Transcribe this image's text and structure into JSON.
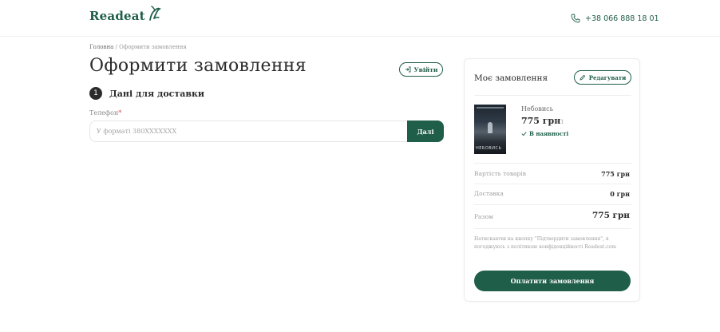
{
  "header": {
    "logo_text": "Readeat",
    "phone": "+38 066 888 18 01"
  },
  "breadcrumb": {
    "home": "Головна",
    "separator": "/",
    "current": "Оформити замовлення"
  },
  "page_title": "Оформити замовлення",
  "login_button": "Увійти",
  "step": {
    "number": "1",
    "title": "Дані для доставки"
  },
  "phone_field": {
    "label": "Телефон",
    "required_mark": "*",
    "placeholder": "У форматі 380XXXXXXX",
    "value": ""
  },
  "next_button": "Далі",
  "order": {
    "title": "Моє замовлення",
    "edit_button": "Редагувати",
    "item": {
      "name": "Небовись",
      "price": "775 грн",
      "qty": "x 1",
      "stock": "В наявності",
      "cover_text": "НЕБОВИСЬ"
    },
    "goods_label": "Вартість товарів",
    "goods_value": "775 грн",
    "delivery_label": "Доставка",
    "delivery_value": "0 грн",
    "total_label": "Разом",
    "total_value": "775 грн",
    "terms": "Натискаючи на кнопку \"Підтвердити замовлення\", я погоджуюсь з політикою конфіденційності Readeat.com",
    "pay_button": "Оплатити замовлення"
  },
  "colors": {
    "brand": "#1f5e48",
    "required": "#d24a4a"
  }
}
